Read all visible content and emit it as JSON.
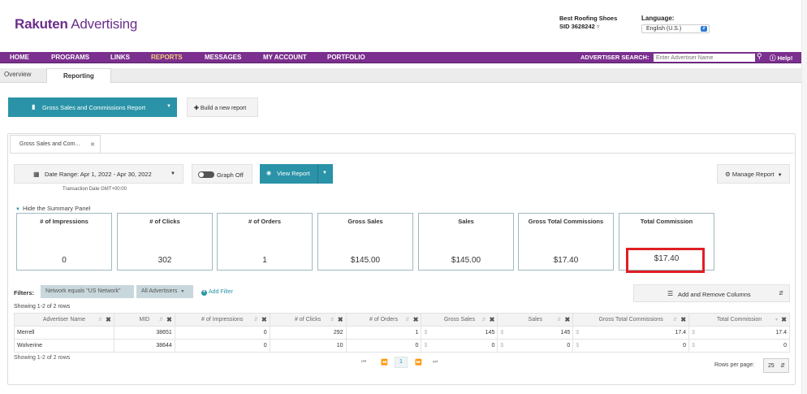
{
  "brand": {
    "name_bold": "Rakuten",
    "name_rest": " Advertising"
  },
  "account": {
    "name": "Best Roofing Shoes",
    "sid": "SID 3628242"
  },
  "language": {
    "label": "Language:",
    "selected": "English (U.S.)"
  },
  "nav": {
    "items": [
      "HOME",
      "PROGRAMS",
      "LINKS",
      "REPORTS",
      "MESSAGES",
      "MY ACCOUNT",
      "PORTFOLIO"
    ],
    "active": "REPORTS",
    "advertiser_search_label": "ADVERTISER SEARCH:",
    "advertiser_search_placeholder": "Enter Advertiser Name",
    "help": "Help!"
  },
  "subtabs": {
    "overview": "Overview",
    "reporting": "Reporting"
  },
  "toolbar": {
    "report_select": "Gross Sales and Commissions Report",
    "build_new": "Build a new report"
  },
  "report_tab": {
    "label": "Gross Sales and Com..."
  },
  "controls": {
    "date_range": "Date Range: Apr 1, 2022 - Apr 30, 2022",
    "timezone_note": "Transaction Date GMT+00:00",
    "graph_toggle": "Graph Off",
    "view_report": "View Report",
    "manage_report": "Manage Report"
  },
  "summary": {
    "toggle_label": "Hide the Summary Panel",
    "cards": [
      {
        "title": "# of Impressions",
        "value": "0"
      },
      {
        "title": "# of Clicks",
        "value": "302"
      },
      {
        "title": "# of Orders",
        "value": "1"
      },
      {
        "title": "Gross Sales",
        "value": "$145.00"
      },
      {
        "title": "Sales",
        "value": "$145.00"
      },
      {
        "title": "Gross Total Commissions",
        "value": "$17.40"
      },
      {
        "title": "Total Commission",
        "value": "$17.40"
      }
    ],
    "highlight_color": "#e01e24"
  },
  "filters": {
    "label": "Filters:",
    "chips": [
      "Network equals \"US Network\"",
      "All Advertisers"
    ],
    "add_filter": "Add Filter",
    "columns_button": "Add and Remove Columns"
  },
  "table": {
    "showing_top": "Showing 1-2 of 2 rows",
    "showing_bottom": "Showing 1-2 of 2 rows",
    "columns": [
      "Advertiser Name",
      "MID",
      "# of Impressions",
      "# of Clicks",
      "# of Orders",
      "Gross Sales",
      "Sales",
      "Gross Total Commissions",
      "Total Commission"
    ],
    "rows": [
      [
        "Merrell",
        "38651",
        "0",
        "292",
        "1",
        "145",
        "145",
        "17.4",
        "17.4"
      ],
      [
        "Wolverine",
        "38644",
        "0",
        "10",
        "0",
        "0",
        "0",
        "0",
        "0"
      ]
    ],
    "currency_symbol": "$"
  },
  "pagination": {
    "page": "1",
    "rows_per_page_label": "Rows per page:",
    "rows_per_page": "25"
  },
  "colors": {
    "nav_purple": "#7b2f8e",
    "teal": "#2a93a7",
    "active_nav": "#f3d27a"
  }
}
